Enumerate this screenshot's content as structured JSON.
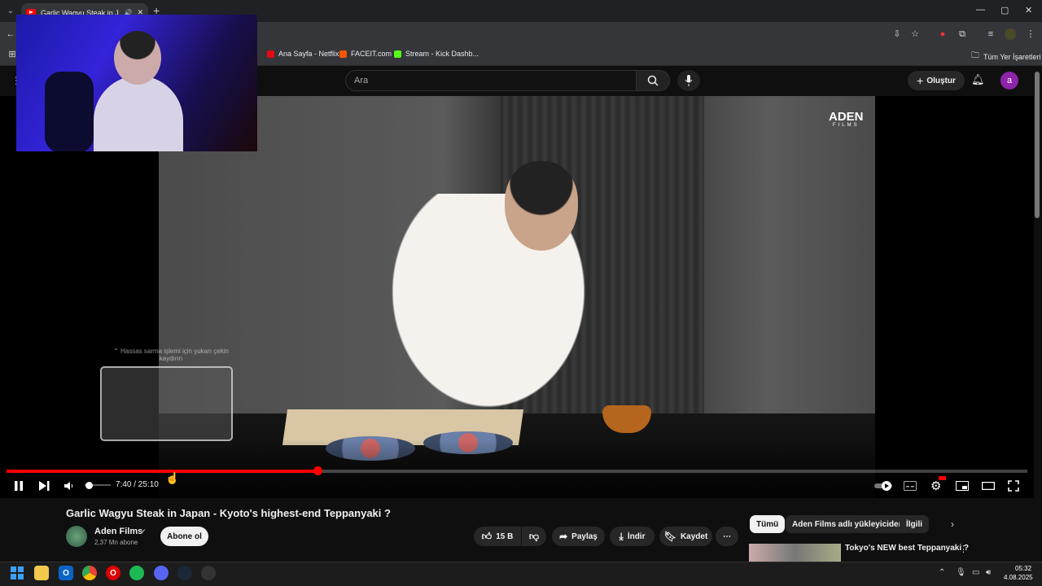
{
  "browser": {
    "tab_title": "Garlic Wagyu Steak in Japan",
    "bookmarks": [
      {
        "label": "Ana Sayfa - Netflix",
        "color": "#e50914"
      },
      {
        "label": "FACEIT.com",
        "color": "#ff5500"
      },
      {
        "label": "Stream - Kick Dashb...",
        "color": "#53fc18"
      }
    ],
    "all_bookmarks": "Tüm Yer İşaretleri"
  },
  "youtube": {
    "search_placeholder": "Ara",
    "create_label": "Oluştur",
    "avatar_letter": "a"
  },
  "player": {
    "watermark_main": "ADEN",
    "watermark_sub": "FILMS",
    "preview_hint": "⌃ Hassas sarma işlemi için yukarı çekin kaydırın",
    "current_time": "7:40",
    "duration": "25:10",
    "time_display": "7:40 / 25:10",
    "progress_percent": 30.5,
    "volume_percent": 15
  },
  "video": {
    "title": "Garlic Wagyu Steak in Japan - Kyoto's highest-end Teppanyaki ?",
    "channel_name": "Aden Films",
    "subscribers": "2,37 Mn abone",
    "subscribe_label": "Abone ol",
    "likes": "15 B",
    "share_label": "Paylaş",
    "download_label": "İndir",
    "save_label": "Kaydet"
  },
  "recommendations": {
    "chips": [
      "Tümü",
      "Aden Films adlı yükleyiciden",
      "İlgili"
    ],
    "first_title": "Tokyo's NEW best Teppanyaki ?"
  },
  "taskbar": {
    "time": "05:32",
    "date": "4.08.2025"
  }
}
